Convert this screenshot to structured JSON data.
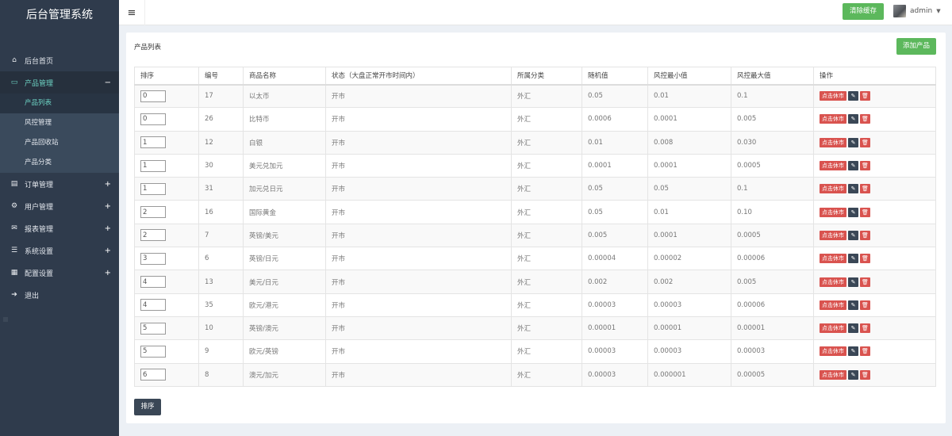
{
  "sidebar": {
    "brand": "后台管理系统",
    "items": [
      {
        "icon": "home-icon",
        "glyph": "⌂",
        "label": "后台首页",
        "sign": ""
      },
      {
        "icon": "laptop-icon",
        "glyph": "▭",
        "label": "产品管理",
        "sign": "−"
      },
      {
        "icon": "book-icon",
        "glyph": "▤",
        "label": "订单管理",
        "sign": "+"
      },
      {
        "icon": "users-icon",
        "glyph": "⚙",
        "label": "用户管理",
        "sign": "+"
      },
      {
        "icon": "envelope-icon",
        "glyph": "✉",
        "label": "报表管理",
        "sign": "+"
      },
      {
        "icon": "list-icon",
        "glyph": "☰",
        "label": "系统设置",
        "sign": "+"
      },
      {
        "icon": "chart-icon",
        "glyph": "▦",
        "label": "配置设置",
        "sign": "+"
      },
      {
        "icon": "signout-icon",
        "glyph": "➔",
        "label": "退出",
        "sign": ""
      }
    ],
    "sub_items": [
      "产品列表",
      "风控管理",
      "产品回收站",
      "产品分类"
    ]
  },
  "topbar": {
    "clear_cache": "清除缓存",
    "user": "admin"
  },
  "panel": {
    "title": "产品列表",
    "add_button": "添加产品",
    "sort_button": "排序"
  },
  "table": {
    "headers": [
      "排序",
      "编号",
      "商品名称",
      "状态（大盘正常开市时间内）",
      "所属分类",
      "随机值",
      "风控最小值",
      "风控最大值",
      "操作"
    ],
    "halt_label": "点击休市",
    "rows": [
      {
        "sort": "0",
        "id": "17",
        "name": "以太币",
        "status": "开市",
        "category": "外汇",
        "random": "0.05",
        "min": "0.01",
        "max": "0.1"
      },
      {
        "sort": "0",
        "id": "26",
        "name": "比特币",
        "status": "开市",
        "category": "外汇",
        "random": "0.0006",
        "min": "0.0001",
        "max": "0.005"
      },
      {
        "sort": "1",
        "id": "12",
        "name": "白银",
        "status": "开市",
        "category": "外汇",
        "random": "0.01",
        "min": "0.008",
        "max": "0.030"
      },
      {
        "sort": "1",
        "id": "30",
        "name": "美元兑加元",
        "status": "开市",
        "category": "外汇",
        "random": "0.0001",
        "min": "0.0001",
        "max": "0.0005"
      },
      {
        "sort": "1",
        "id": "31",
        "name": "加元兑日元",
        "status": "开市",
        "category": "外汇",
        "random": "0.05",
        "min": "0.05",
        "max": "0.1"
      },
      {
        "sort": "2",
        "id": "16",
        "name": "国际黄金",
        "status": "开市",
        "category": "外汇",
        "random": "0.05",
        "min": "0.01",
        "max": "0.10"
      },
      {
        "sort": "2",
        "id": "7",
        "name": "英镑/美元",
        "status": "开市",
        "category": "外汇",
        "random": "0.005",
        "min": "0.0001",
        "max": "0.0005"
      },
      {
        "sort": "3",
        "id": "6",
        "name": "英镑/日元",
        "status": "开市",
        "category": "外汇",
        "random": "0.00004",
        "min": "0.00002",
        "max": "0.00006"
      },
      {
        "sort": "4",
        "id": "13",
        "name": "美元/日元",
        "status": "开市",
        "category": "外汇",
        "random": "0.002",
        "min": "0.002",
        "max": "0.005"
      },
      {
        "sort": "4",
        "id": "35",
        "name": "欧元/港元",
        "status": "开市",
        "category": "外汇",
        "random": "0.00003",
        "min": "0.00003",
        "max": "0.00006"
      },
      {
        "sort": "5",
        "id": "10",
        "name": "英镑/澳元",
        "status": "开市",
        "category": "外汇",
        "random": "0.00001",
        "min": "0.00001",
        "max": "0.00001"
      },
      {
        "sort": "5",
        "id": "9",
        "name": "欧元/英镑",
        "status": "开市",
        "category": "外汇",
        "random": "0.00003",
        "min": "0.00003",
        "max": "0.00003"
      },
      {
        "sort": "6",
        "id": "8",
        "name": "澳元/加元",
        "status": "开市",
        "category": "外汇",
        "random": "0.00003",
        "min": "0.000001",
        "max": "0.00005"
      }
    ]
  },
  "colors": {
    "sidebar_bg": "#2f3b4c",
    "accent_teal": "#6dd3c4",
    "success": "#5cb85c",
    "danger": "#d9534f",
    "dark_button": "#3a4756"
  }
}
